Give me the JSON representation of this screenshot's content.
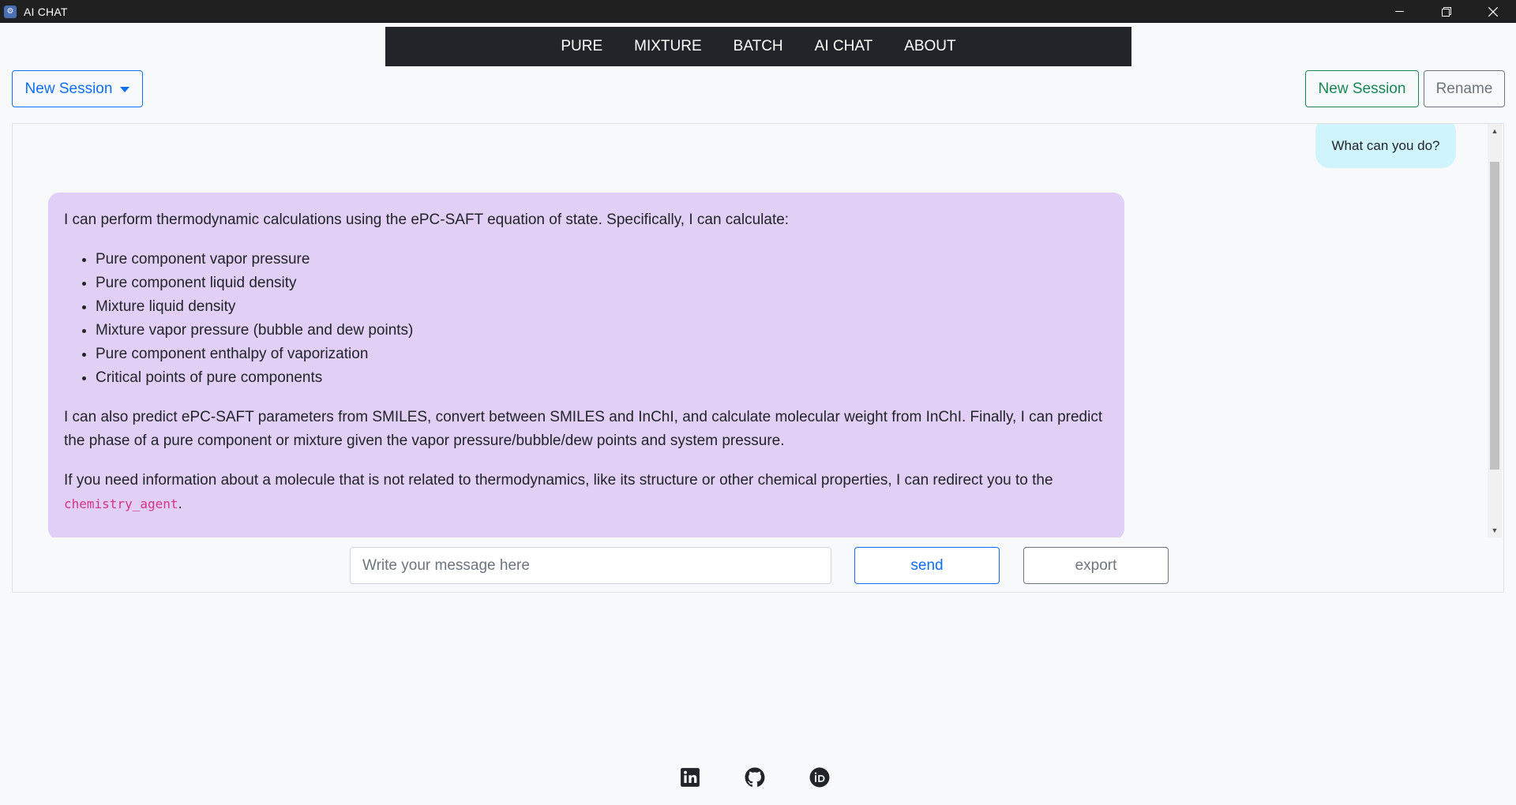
{
  "window": {
    "title": "AI CHAT",
    "icon": "app-icon",
    "controls": [
      "minimize-icon",
      "restore-icon",
      "close-icon"
    ]
  },
  "navbar": {
    "items": [
      {
        "label": "PURE"
      },
      {
        "label": "MIXTURE"
      },
      {
        "label": "BATCH"
      },
      {
        "label": "AI CHAT"
      },
      {
        "label": "ABOUT"
      }
    ]
  },
  "session": {
    "dropdown_label": "New Session",
    "new_session_label": "New Session",
    "rename_label": "Rename"
  },
  "chat": {
    "messages": [
      {
        "role": "user",
        "text": "What can you do?"
      },
      {
        "role": "assistant",
        "intro": "I can perform thermodynamic calculations using the ePC-SAFT equation of state. Specifically, I can calculate:",
        "items": [
          "Pure component vapor pressure",
          "Pure component liquid density",
          "Mixture liquid density",
          "Mixture vapor pressure (bubble and dew points)",
          "Pure component enthalpy of vaporization",
          "Critical points of pure components"
        ],
        "paragraph2": "I can also predict ePC-SAFT parameters from SMILES, convert between SMILES and InChI, and calculate molecular weight from InChI. Finally, I can predict the phase of a pure component or mixture given the vapor pressure/bubble/dew points and system pressure.",
        "paragraph3_start": "If you need information about a molecule that is not related to thermodynamics, like its structure or other chemical properties, I can redirect you to the ",
        "paragraph3_code": "chemistry_agent",
        "paragraph3_end": "."
      }
    ]
  },
  "input": {
    "placeholder": "Write your message here",
    "value": "",
    "send_label": "send",
    "export_label": "export"
  },
  "footer": {
    "icons": [
      "linkedin-icon",
      "github-icon",
      "orcid-icon"
    ]
  },
  "colors": {
    "navbar_bg": "#212529",
    "user_bubble": "#cff4fc",
    "assistant_bubble": "#e2cff5",
    "primary": "#0d6efd",
    "success": "#198754",
    "secondary": "#6c757d",
    "code": "#d63384"
  }
}
